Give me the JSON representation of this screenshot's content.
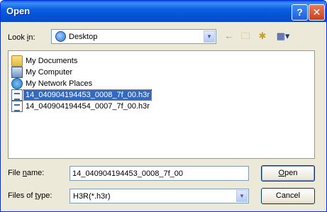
{
  "window": {
    "title": "Open",
    "help_glyph": "?",
    "close_glyph": "✕"
  },
  "toolbar": {
    "look_in_prefix": "Look ",
    "look_in_underlined": "i",
    "look_in_suffix": "n:",
    "look_in_value": "Desktop",
    "back_glyph": "←",
    "up_glyph": "🗀",
    "newfolder_glyph": "✱",
    "views_glyph": "▦▾"
  },
  "file_list": {
    "items": [
      {
        "label": "My Documents",
        "icon": "folder-icon"
      },
      {
        "label": "My Computer",
        "icon": "computer-icon"
      },
      {
        "label": "My Network Places",
        "icon": "network-places-icon"
      },
      {
        "label": "14_040904194453_0008_7f_00.h3r",
        "icon": "file-icon",
        "selected": true
      },
      {
        "label": "14_040904194454_0007_7f_00.h3r",
        "icon": "file-icon"
      }
    ]
  },
  "form": {
    "file_name_prefix": "File ",
    "file_name_underlined": "n",
    "file_name_suffix": "ame:",
    "file_name_value": "14_040904194453_0008_7f_00",
    "files_of_type_prefix": "Files of ",
    "files_of_type_underlined": "t",
    "files_of_type_suffix": "ype:",
    "files_of_type_value": "H3R(*.h3r)"
  },
  "buttons": {
    "open_underlined": "O",
    "open_rest": "pen",
    "cancel": "Cancel"
  },
  "colors": {
    "title_bar": "#0a5fe0",
    "selection": "#316ac5",
    "dialog_bg": "#ece9d8"
  }
}
